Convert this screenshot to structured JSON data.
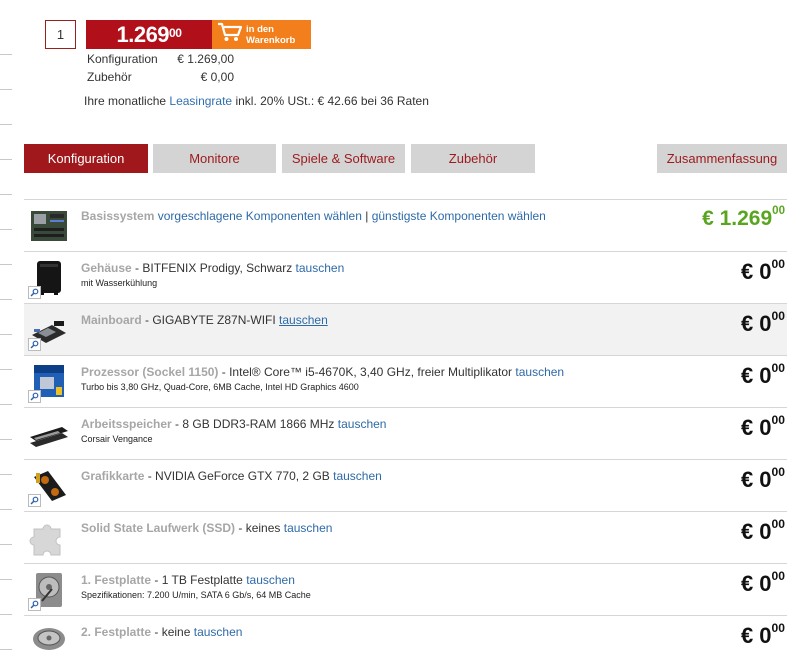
{
  "purchase": {
    "quantity": "1",
    "price_main": "1.269",
    "price_cents": "00",
    "cart_line1": "in den",
    "cart_line2": "Warenkorb",
    "configuration_label": "Konfiguration",
    "configuration_value": "€ 1.269,00",
    "accessories_label": "Zubehör",
    "accessories_value": "€ 0,00",
    "leasing_prefix": "Ihre monatliche",
    "leasing_link": "Leasingrate",
    "leasing_suffix": "inkl. 20% USt.: € 42.66 bei 36 Raten"
  },
  "tabs": [
    {
      "label": "Konfiguration",
      "active": true
    },
    {
      "label": "Monitore",
      "active": false
    },
    {
      "label": "Spiele & Software",
      "active": false
    },
    {
      "label": "Zubehör",
      "active": false
    },
    {
      "label": "Zusammenfassung",
      "active": false
    }
  ],
  "rows": [
    {
      "category": "Basissystem",
      "value": "",
      "link1": "vorgeschlagene Komponenten wählen",
      "separator": "|",
      "link2": "günstigste Komponenten wählen",
      "sub": "",
      "price_main": "€ 1.269",
      "price_cents": "00",
      "icon": "motherboard-icon"
    },
    {
      "category": "Gehäuse",
      "value": "- BITFENIX Prodigy, Schwarz",
      "link1": "tauschen",
      "sub": "mit Wasserkühlung",
      "price_main": "€ 0",
      "price_cents": "00",
      "icon": "case-icon"
    },
    {
      "category": "Mainboard",
      "value": "- GIGABYTE Z87N-WIFI",
      "link1": "tauschen",
      "sub": "",
      "price_main": "€ 0",
      "price_cents": "00",
      "icon": "mainboard-icon"
    },
    {
      "category": "Prozessor (Sockel 1150)",
      "value": "- Intel® Core™ i5-4670K, 3,40 GHz, freier Multiplikator",
      "link1": "tauschen",
      "sub": "Turbo bis 3,80 GHz, Quad-Core, 6MB Cache, Intel HD Graphics 4600",
      "price_main": "€ 0",
      "price_cents": "00",
      "icon": "cpu-box-icon"
    },
    {
      "category": "Arbeitsspeicher",
      "value": "- 8 GB DDR3-RAM 1866 MHz",
      "link1": "tauschen",
      "sub": "Corsair Vengance",
      "price_main": "€ 0",
      "price_cents": "00",
      "icon": "ram-icon"
    },
    {
      "category": "Grafikkarte",
      "value": "- NVIDIA GeForce GTX 770, 2 GB",
      "link1": "tauschen",
      "sub": "",
      "price_main": "€ 0",
      "price_cents": "00",
      "icon": "graphics-card-icon"
    },
    {
      "category": "Solid State Laufwerk (SSD)",
      "value": "- keines",
      "link1": "tauschen",
      "sub": "",
      "price_main": "€ 0",
      "price_cents": "00",
      "icon": "puzzle-placeholder-icon"
    },
    {
      "category": "1. Festplatte",
      "value": "- 1 TB Festplatte",
      "link1": "tauschen",
      "sub": "Spezifikationen: 7.200 U/min, SATA 6 Gb/s, 64 MB Cache",
      "price_main": "€ 0",
      "price_cents": "00",
      "icon": "hard-drive-icon"
    },
    {
      "category": "2. Festplatte",
      "value": "- keine",
      "link1": "tauschen",
      "sub": "",
      "price_main": "€ 0",
      "price_cents": "00",
      "icon": "hard-drive-icon"
    }
  ],
  "colors": {
    "price_red": "#b10f1a",
    "cart_orange": "#f27f1b",
    "tab_active": "#a0181c",
    "tab_inactive": "#d4d4d4",
    "link_blue": "#2e6aa8",
    "price_green": "#5aa520"
  }
}
